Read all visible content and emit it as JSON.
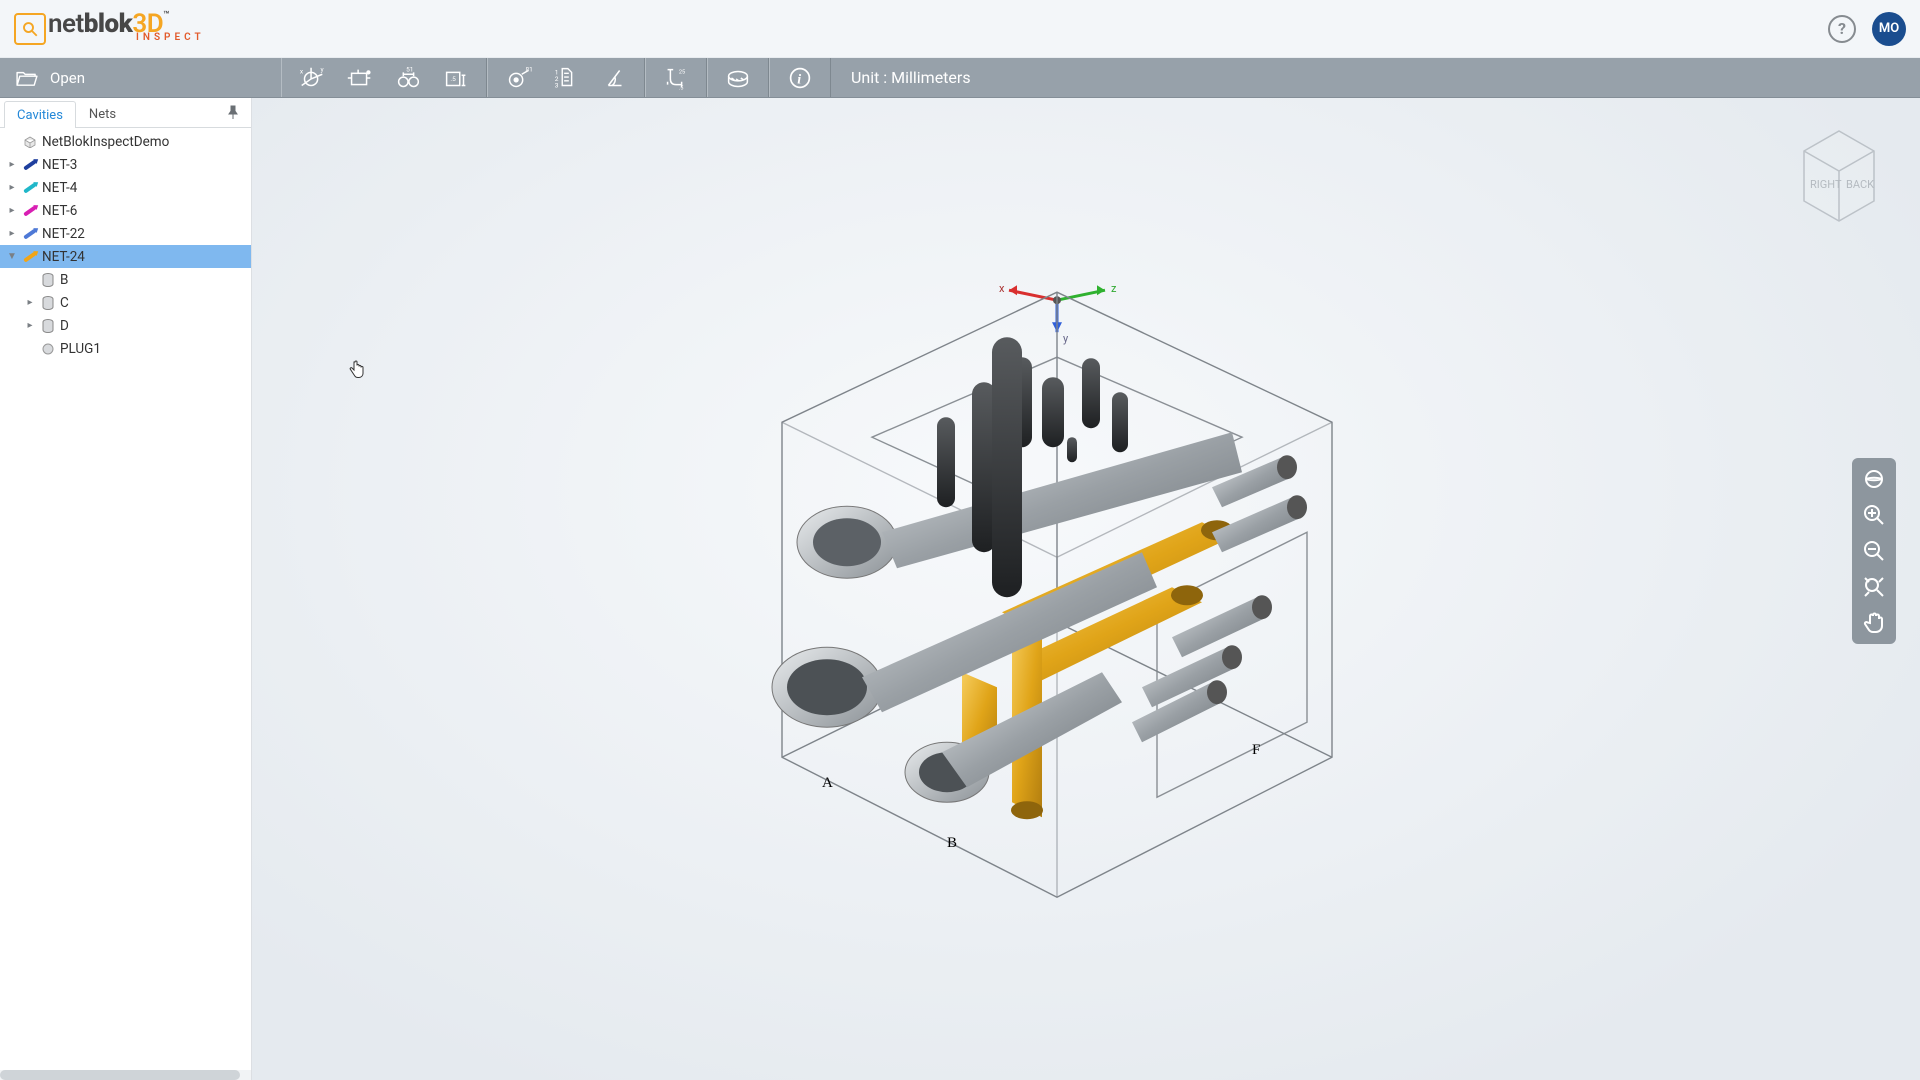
{
  "header": {
    "logo_prefix": "net",
    "logo_mid": "blok",
    "logo_suffix": "3D",
    "logo_sub": "INSPECT",
    "help_tooltip": "Help",
    "avatar_initials": "MO"
  },
  "toolbar": {
    "open_label": "Open",
    "unit_label": "Unit : Millimeters",
    "tool_names": [
      "axis-origin",
      "block-dim",
      "dim-1",
      "dim-2",
      "cavity-callout",
      "step-list",
      "angle",
      "bend",
      "section-view",
      "info"
    ]
  },
  "sidebar": {
    "tabs": [
      {
        "key": "cavities",
        "label": "Cavities",
        "active": true
      },
      {
        "key": "nets",
        "label": "Nets",
        "active": false
      }
    ],
    "root_label": "NetBlokInspectDemo",
    "items": [
      {
        "label": "NET-3",
        "color": "#1f3f9e",
        "expanded": false,
        "selected": false,
        "children": []
      },
      {
        "label": "NET-4",
        "color": "#20b7c9",
        "expanded": false,
        "selected": false,
        "children": []
      },
      {
        "label": "NET-6",
        "color": "#d81fb3",
        "expanded": false,
        "selected": false,
        "children": []
      },
      {
        "label": "NET-22",
        "color": "#4e79d6",
        "expanded": false,
        "selected": false,
        "children": []
      },
      {
        "label": "NET-24",
        "color": "#f2a516",
        "expanded": true,
        "selected": true,
        "children": [
          {
            "label": "B",
            "icon": "cyl",
            "expandable": false
          },
          {
            "label": "C",
            "icon": "cyl",
            "expandable": true
          },
          {
            "label": "D",
            "icon": "cyl",
            "expandable": true
          },
          {
            "label": "PLUG1",
            "icon": "sphere",
            "expandable": false
          }
        ]
      }
    ]
  },
  "viewcube": {
    "faces": [
      "RIGHT",
      "BACK"
    ],
    "top": ""
  },
  "view_tools": [
    "orbit",
    "zoom-in",
    "zoom-out",
    "fit",
    "pan"
  ],
  "model": {
    "face_labels": [
      "A",
      "B",
      "F"
    ],
    "axis_labels": [
      "x",
      "y",
      "z"
    ]
  }
}
